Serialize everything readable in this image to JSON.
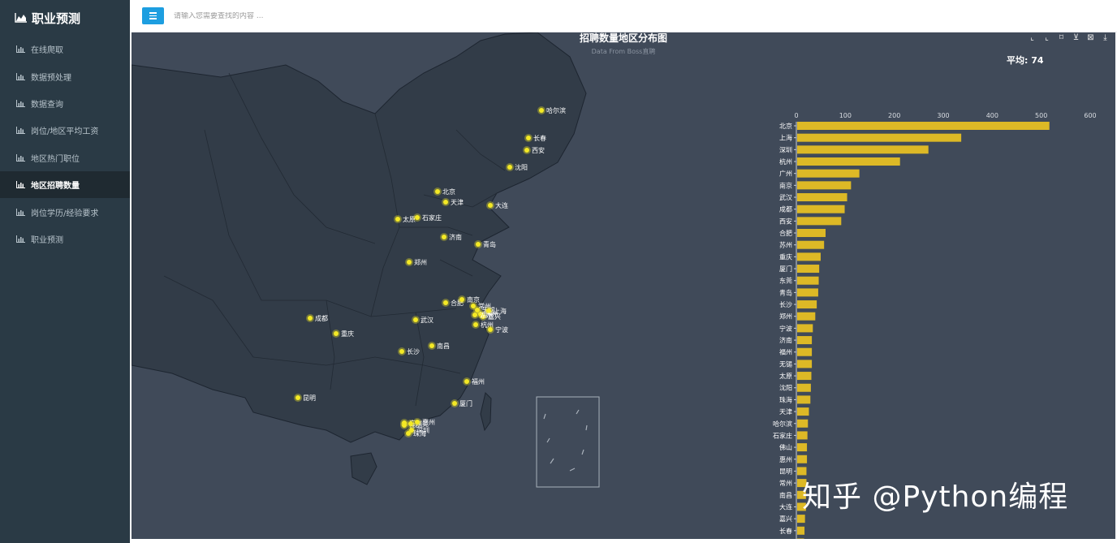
{
  "app": {
    "title": "职业预测"
  },
  "sidebar": {
    "items": [
      {
        "label": "在线爬取",
        "active": false
      },
      {
        "label": "数据预处理",
        "active": false
      },
      {
        "label": "数据查询",
        "active": false
      },
      {
        "label": "岗位/地区平均工资",
        "active": false
      },
      {
        "label": "地区热门职位",
        "active": false
      },
      {
        "label": "地区招聘数量",
        "active": true
      },
      {
        "label": "岗位学历/经验要求",
        "active": false
      },
      {
        "label": "职业预测",
        "active": false
      }
    ]
  },
  "topbar": {
    "search_placeholder": "请输入您需要查找的内容 ..."
  },
  "chart": {
    "title": "招聘数量地区分布图",
    "subtitle": "Data From Boss直聘",
    "average_label": "平均: 74",
    "toolbox": [
      "zoom-icon",
      "zoom-reset-icon",
      "rect-select-icon",
      "lasso-icon",
      "clear-select-icon",
      "save-image-icon"
    ]
  },
  "watermark": "知乎 @Python编程",
  "colors": {
    "sidebar": "#2a3a45",
    "panel": "#404a59",
    "bar": "#ddb926",
    "accent": "#1d9ee0",
    "point": "#f4e925"
  },
  "chart_data": {
    "type": "bar",
    "orientation": "horizontal",
    "xlim": [
      0,
      600
    ],
    "xticks": [
      0,
      100,
      200,
      300,
      400,
      500,
      600
    ],
    "categories": [
      "北京",
      "上海",
      "深圳",
      "杭州",
      "广州",
      "南京",
      "武汉",
      "成都",
      "西安",
      "合肥",
      "苏州",
      "重庆",
      "厦门",
      "东莞",
      "青岛",
      "长沙",
      "郑州",
      "宁波",
      "济南",
      "福州",
      "无锡",
      "太原",
      "沈阳",
      "珠海",
      "天津",
      "哈尔滨",
      "石家庄",
      "佛山",
      "惠州",
      "昆明",
      "常州",
      "南昌",
      "大连",
      "嘉兴",
      "长春",
      "湖州"
    ],
    "values": [
      515,
      335,
      268,
      210,
      127,
      110,
      102,
      97,
      90,
      58,
      55,
      48,
      45,
      44,
      43,
      40,
      37,
      32,
      30,
      30,
      30,
      29,
      28,
      27,
      24,
      22,
      21,
      20,
      20,
      19,
      19,
      18,
      18,
      16,
      15,
      14
    ]
  },
  "map_cities": [
    {
      "name": "哈尔滨"
    },
    {
      "name": "长春"
    },
    {
      "name": "西安"
    },
    {
      "name": "沈阳"
    },
    {
      "name": "北京"
    },
    {
      "name": "天津"
    },
    {
      "name": "大连"
    },
    {
      "name": "太原"
    },
    {
      "name": "石家庄"
    },
    {
      "name": "济南"
    },
    {
      "name": "青岛"
    },
    {
      "name": "郑州"
    },
    {
      "name": "合肥"
    },
    {
      "name": "南京"
    },
    {
      "name": "常州"
    },
    {
      "name": "无锡"
    },
    {
      "name": "苏州"
    },
    {
      "name": "上海"
    },
    {
      "name": "嘉兴"
    },
    {
      "name": "湖州"
    },
    {
      "name": "杭州"
    },
    {
      "name": "宁波"
    },
    {
      "name": "成都"
    },
    {
      "name": "重庆"
    },
    {
      "name": "武汉"
    },
    {
      "name": "长沙"
    },
    {
      "name": "南昌"
    },
    {
      "name": "福州"
    },
    {
      "name": "昆明"
    },
    {
      "name": "厦门"
    },
    {
      "name": "广州"
    },
    {
      "name": "佛山"
    },
    {
      "name": "东莞"
    },
    {
      "name": "惠州"
    },
    {
      "name": "深圳"
    },
    {
      "name": "珠海"
    }
  ]
}
